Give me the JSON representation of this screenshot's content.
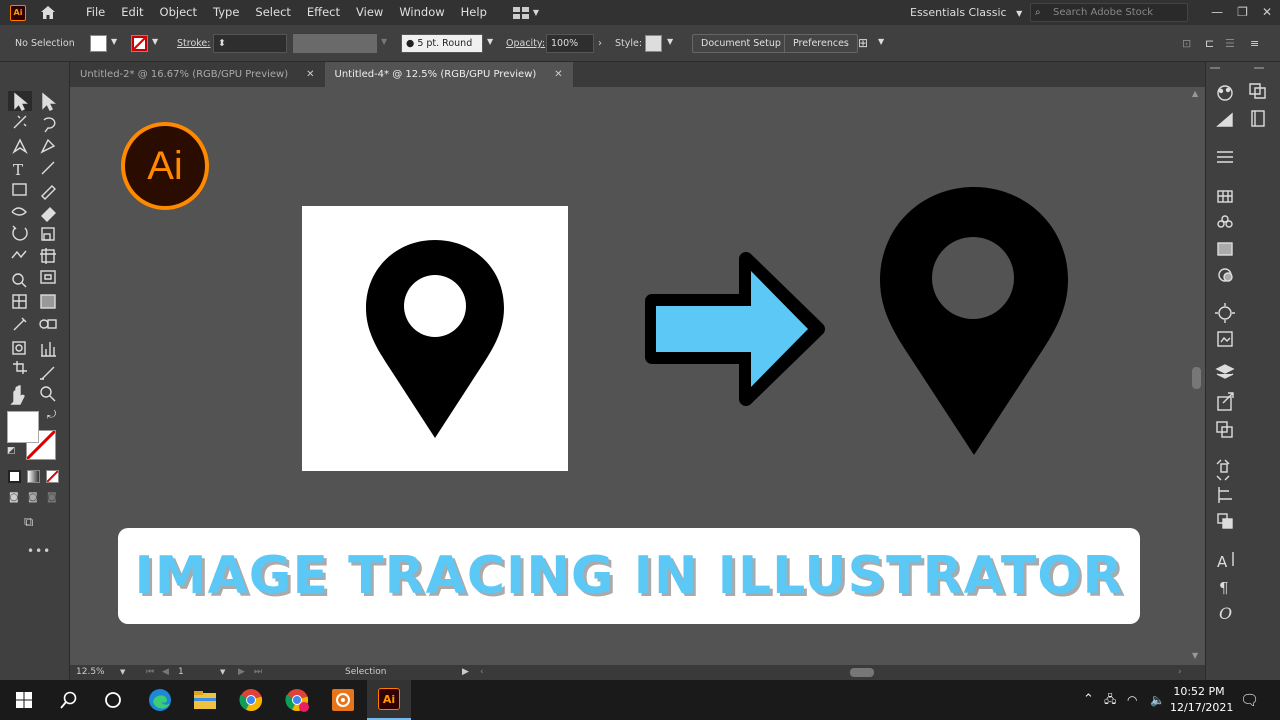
{
  "app": {
    "badge": "Ai"
  },
  "menu": [
    "File",
    "Edit",
    "Object",
    "Type",
    "Select",
    "Effect",
    "View",
    "Window",
    "Help"
  ],
  "workspace": "Essentials Classic",
  "stock_search_placeholder": "Search Adobe Stock",
  "control": {
    "selection": "No Selection",
    "stroke_label": "Stroke:",
    "brush": "5 pt. Round",
    "opacity_label": "Opacity:",
    "opacity_value": "100%",
    "style_label": "Style:",
    "document_setup": "Document Setup",
    "preferences": "Preferences"
  },
  "tabs": [
    {
      "label": "Untitled-2* @ 16.67% (RGB/GPU Preview)",
      "active": false
    },
    {
      "label": "Untitled-4* @ 12.5% (RGB/GPU Preview)",
      "active": true
    }
  ],
  "canvas": {
    "logo_text": "Ai",
    "banner_text": "IMAGE TRACING IN ILLUSTRATOR",
    "colors": {
      "arrow": "#5bc8f5",
      "logo_accent": "#ff8a00",
      "logo_bg": "#2a0d00"
    }
  },
  "status": {
    "zoom": "12.5%",
    "artboard": "1",
    "tool": "Selection"
  },
  "clock": {
    "time": "10:52 PM",
    "date": "12/17/2021"
  }
}
